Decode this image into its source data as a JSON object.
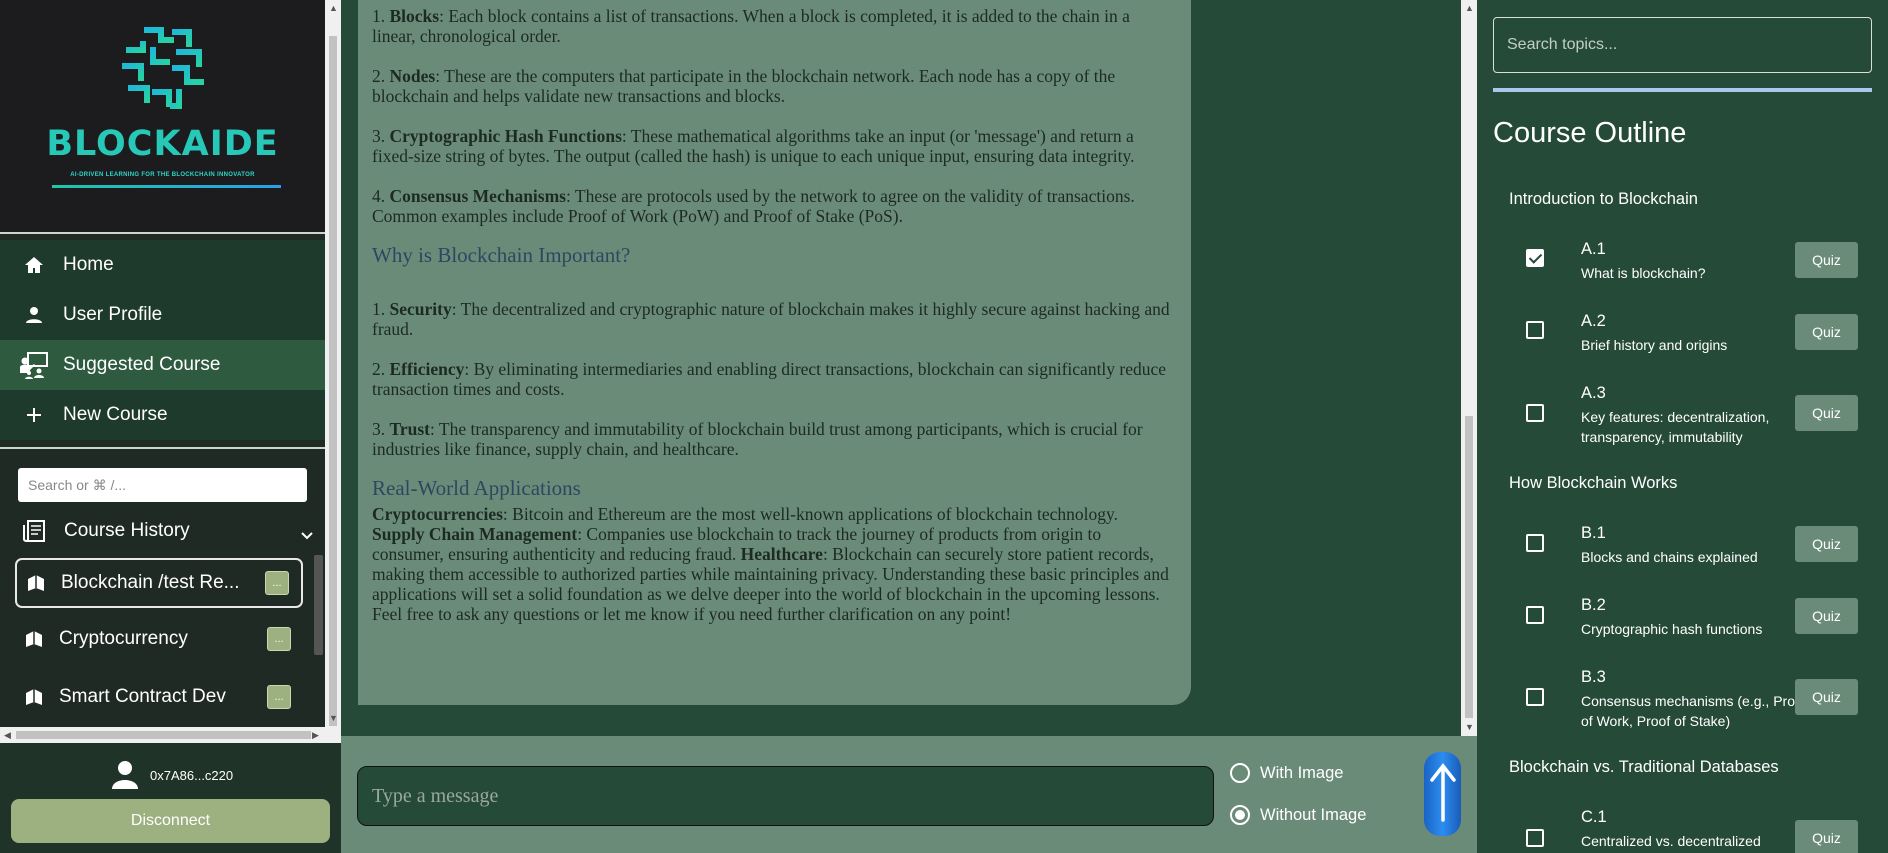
{
  "brand": {
    "name": "BLOCKAIDE",
    "tagline": "AI-DRIVEN LEARNING FOR THE BLOCKCHAIN INNOVATOR"
  },
  "nav": {
    "items": [
      {
        "label": "Home",
        "icon": "home-icon"
      },
      {
        "label": "User Profile",
        "icon": "user-icon"
      },
      {
        "label": "Suggested Course",
        "icon": "teacher-icon",
        "active": true
      },
      {
        "label": "New Course",
        "icon": "plus-icon"
      }
    ]
  },
  "history": {
    "search_placeholder": "Search or ⌘ /...",
    "title": "Course History",
    "items": [
      {
        "label": "Blockchain /test Re...",
        "selected": true
      },
      {
        "label": "Cryptocurrency"
      },
      {
        "label": "Smart Contract Dev"
      }
    ],
    "item_button_label": "..."
  },
  "wallet": {
    "address": "0x7A86...c220",
    "disconnect_label": "Disconnect"
  },
  "content": {
    "p1_bold": "Blocks",
    "p1_num": "1. ",
    "p1_rest": ": Each block contains a list of transactions. When a block is completed, it is added to the chain in a linear, chronological order.",
    "p2_num": "2. ",
    "p2_bold": "Nodes",
    "p2_rest": ": These are the computers that participate in the blockchain network. Each node has a copy of the blockchain and helps validate new transactions and blocks.",
    "p3_num": "3. ",
    "p3_bold": "Cryptographic Hash Functions",
    "p3_rest": ": These mathematical algorithms take an input (or 'message') and return a fixed-size string of bytes. The output (called the hash) is unique to each unique input, ensuring data integrity.",
    "p4_num": "4. ",
    "p4_bold": "Consensus Mechanisms",
    "p4_rest": ": These are protocols used by the network to agree on the validity of transactions. Common examples include Proof of Work (PoW) and Proof of Stake (PoS).",
    "h_why": "Why is Blockchain Important?",
    "w1_num": "1. ",
    "w1_bold": "Security",
    "w1_rest": ": The decentralized and cryptographic nature of blockchain makes it highly secure against hacking and fraud.",
    "w2_num": "2. ",
    "w2_bold": "Efficiency",
    "w2_rest": ": By eliminating intermediaries and enabling direct transactions, blockchain can significantly reduce transaction times and costs.",
    "w3_num": "3. ",
    "w3_bold": "Trust",
    "w3_rest": ": The transparency and immutability of blockchain build trust among participants, which is crucial for industries like finance, supply chain, and healthcare.",
    "h_real": "Real-World Applications",
    "r_bold1": "Cryptocurrencies",
    "r_text1": ": Bitcoin and Ethereum are the most well-known applications of blockchain technology. ",
    "r_bold2": "Supply Chain Management",
    "r_text2": ": Companies use blockchain to track the journey of products from origin to consumer, ensuring authenticity and reducing fraud. ",
    "r_bold3": "Healthcare",
    "r_text3": ": Blockchain can securely store patient records, making them accessible to authorized parties while maintaining privacy. Understanding these basic principles and applications will set a solid foundation as we delve deeper into the world of blockchain in the upcoming lessons. Feel free to ask any questions or let me know if you need further clarification on any point!"
  },
  "composer": {
    "placeholder": "Type a message",
    "option_with": "With Image",
    "option_without": "Without Image",
    "selected": "Without Image"
  },
  "outline": {
    "search_placeholder": "Search topics...",
    "title": "Course Outline",
    "quiz_label": "Quiz",
    "sections": [
      {
        "title": "Introduction to Blockchain",
        "lessons": [
          {
            "code": "A.1",
            "desc": "What is blockchain?",
            "done": true
          },
          {
            "code": "A.2",
            "desc": "Brief history and origins",
            "done": false
          },
          {
            "code": "A.3",
            "desc": "Key features: decentralization, transparency, immutability",
            "done": false
          }
        ]
      },
      {
        "title": "How Blockchain Works",
        "lessons": [
          {
            "code": "B.1",
            "desc": "Blocks and chains explained",
            "done": false
          },
          {
            "code": "B.2",
            "desc": "Cryptographic hash functions",
            "done": false
          },
          {
            "code": "B.3",
            "desc": "Consensus mechanisms (e.g., Proof of Work, Proof of Stake)",
            "done": false
          }
        ]
      },
      {
        "title": "Blockchain vs. Traditional Databases",
        "lessons": [
          {
            "code": "C.1",
            "desc": "Centralized vs. decentralized",
            "done": false
          }
        ]
      }
    ]
  }
}
